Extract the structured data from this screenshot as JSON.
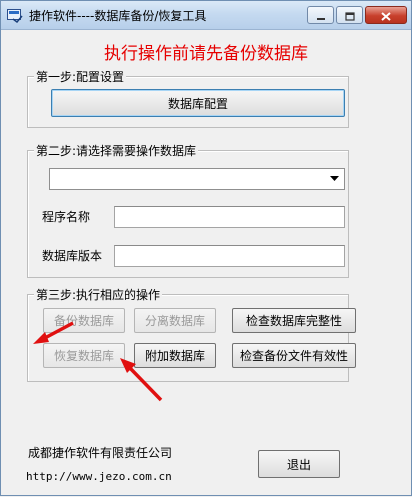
{
  "window": {
    "title": "捷作软件----数据库备份/恢复工具",
    "controls": [
      "minimize",
      "maximize",
      "close"
    ]
  },
  "warning": "执行操作前请先备份数据库",
  "step1": {
    "legend": "第一步:配置设置",
    "config_button": "数据库配置"
  },
  "step2": {
    "legend": "第二步:请选择需要操作数据库",
    "database_select_value": "",
    "program_name_label": "程序名称",
    "program_name_value": "",
    "db_version_label": "数据库版本",
    "db_version_value": ""
  },
  "step3": {
    "legend": "第三步:执行相应的操作",
    "backup_button": "备份数据库",
    "detach_button": "分离数据库",
    "check_integrity_button": "检查数据库完整性",
    "restore_button": "恢复数据库",
    "attach_button": "附加数据库",
    "check_backup_button": "检查备份文件有效性"
  },
  "footer": {
    "company": "成都捷作软件有限责任公司",
    "url": "http://www.jezo.com.cn",
    "exit_button": "退出"
  },
  "colors": {
    "warning_red": "#e60000",
    "arrow_red": "#e01010"
  }
}
